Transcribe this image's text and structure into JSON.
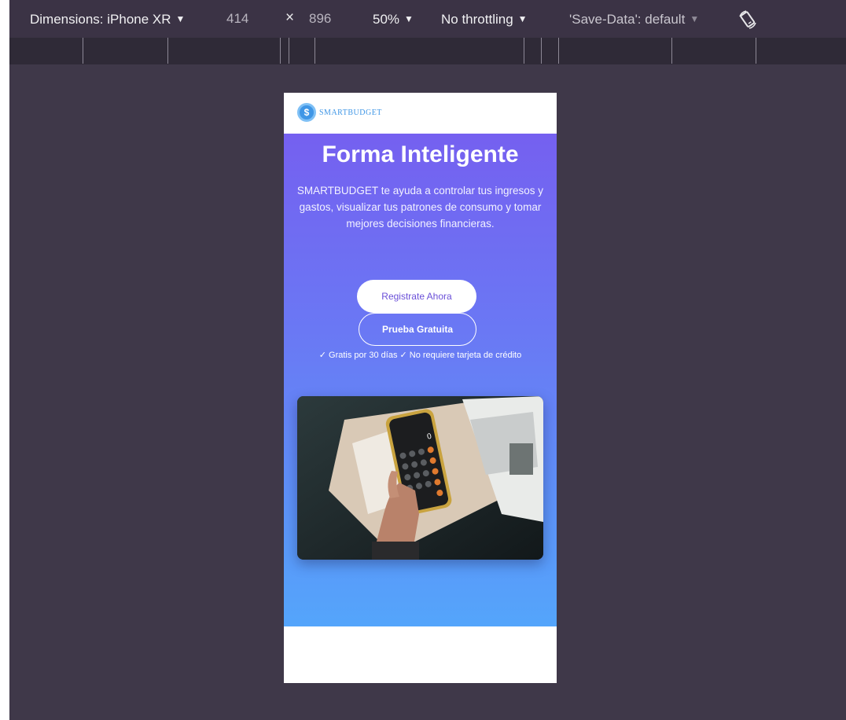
{
  "toolbar": {
    "dimensions_label": "Dimensions: iPhone XR",
    "width": "414",
    "times": "×",
    "height": "896",
    "zoom": "50%",
    "throttling": "No throttling",
    "save_data": "'Save-Data': default",
    "caret": "▼",
    "icons": [
      "rotate-icon"
    ]
  },
  "site": {
    "logo_symbol": "$",
    "logo_text": "SMARTBUDGET",
    "hero_title": "Forma Inteligente",
    "hero_description": "SMARTBUDGET te ayuda a controlar tus ingresos y gastos, visualizar tus patrones de consumo y tomar mejores decisiones financieras.",
    "cta_primary": "Registrate Ahora",
    "cta_secondary": "Prueba Gratuita",
    "note": "✓ Gratis por 30 días ✓ No requiere tarjeta de crédito",
    "colors": {
      "gradient_top": "#7560f0",
      "gradient_bottom": "#54a5fb",
      "brand_blue": "#3f96e6",
      "primary_text": "#6a4fd8"
    }
  }
}
